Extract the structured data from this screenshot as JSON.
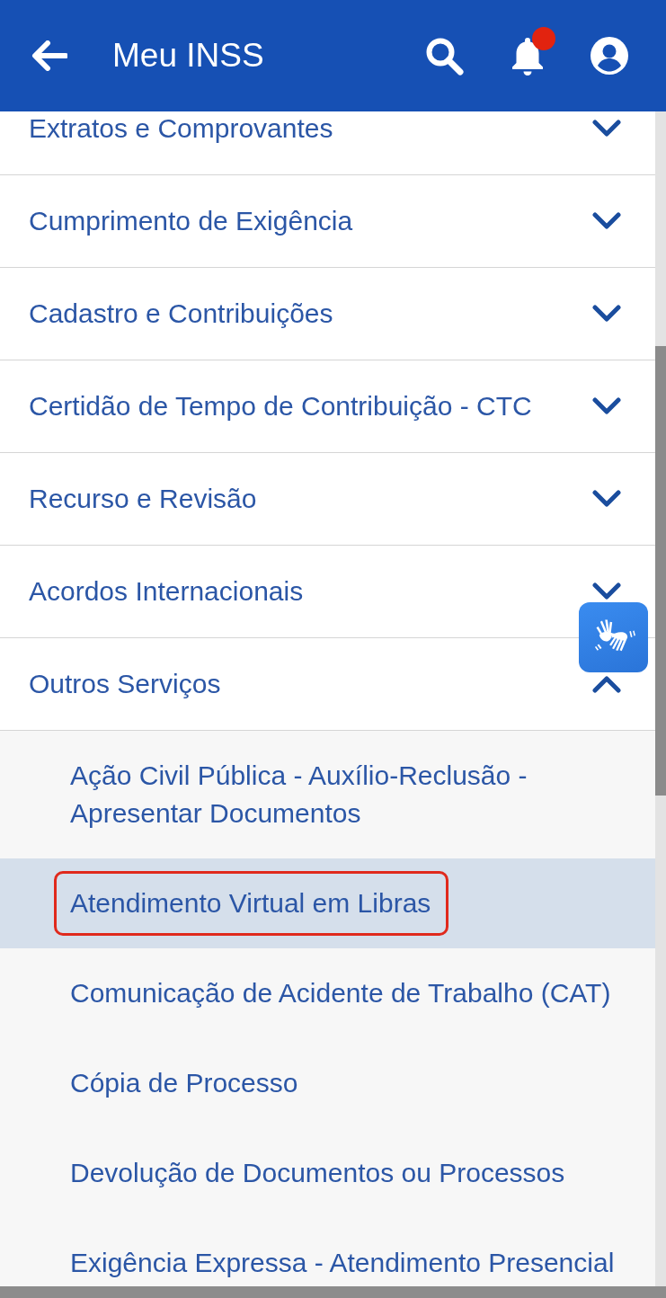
{
  "app_bar": {
    "title": "Meu INSS",
    "has_notification": true
  },
  "menu": [
    {
      "label": "Extratos e Comprovantes",
      "expanded": false
    },
    {
      "label": "Cumprimento de Exigência",
      "expanded": false
    },
    {
      "label": "Cadastro e Contribuições",
      "expanded": false
    },
    {
      "label": "Certidão de Tempo de Contribuição - CTC",
      "expanded": false
    },
    {
      "label": "Recurso e Revisão",
      "expanded": false
    },
    {
      "label": "Acordos Internacionais",
      "expanded": false
    },
    {
      "label": "Outros Serviços",
      "expanded": true,
      "children": [
        {
          "label": "Ação Civil Pública - Auxílio-Reclusão - Apresentar Documentos",
          "selected": false,
          "highlighted": false
        },
        {
          "label": "Atendimento Virtual em Libras",
          "selected": true,
          "highlighted": true
        },
        {
          "label": "Comunicação de Acidente de Trabalho (CAT)",
          "selected": false,
          "highlighted": false
        },
        {
          "label": "Cópia de Processo",
          "selected": false,
          "highlighted": false
        },
        {
          "label": "Devolução de Documentos ou Processos",
          "selected": false,
          "highlighted": false
        },
        {
          "label": "Exigência Expressa - Atendimento Presencial",
          "selected": false,
          "highlighted": false
        }
      ]
    }
  ]
}
